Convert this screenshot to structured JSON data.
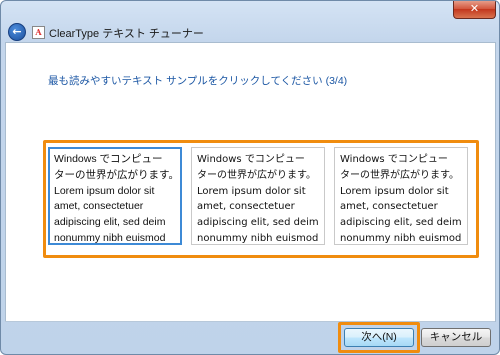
{
  "window": {
    "title": "ClearType テキスト チューナー",
    "app_icon_glyph": "A",
    "back_glyph": "←",
    "close_glyph": "✕"
  },
  "content": {
    "instruction": "最も読みやすいテキスト サンプルをクリックしてください (3/4)"
  },
  "samples": [
    {
      "selected": true,
      "lines": [
        "Windows でコンピュー",
        "ターの世界が広がります。",
        "Lorem ipsum dolor sit",
        "amet, consectetuer",
        "adipiscing elit, sed deim",
        "nonummy nibh euismod"
      ]
    },
    {
      "selected": false,
      "lines": [
        "Windows でコンピュー",
        "ターの世界が広がります。",
        "Lorem ipsum dolor sit",
        "amet, consectetuer",
        "adipiscing elit, sed deim",
        "nonummy nibh euismod"
      ]
    },
    {
      "selected": false,
      "lines": [
        "Windows でコンピュー",
        "ターの世界が広がります。",
        "Lorem ipsum dolor sit",
        "amet, consectetuer",
        "adipiscing elit, sed deim",
        "nonummy nibh euismod"
      ]
    }
  ],
  "buttons": {
    "next_label": "次へ(N)",
    "cancel_label": "キャンセル"
  },
  "colors": {
    "highlight": "#f08c0f",
    "selection": "#3d8ad6",
    "instruction_text": "#1c57a4"
  }
}
